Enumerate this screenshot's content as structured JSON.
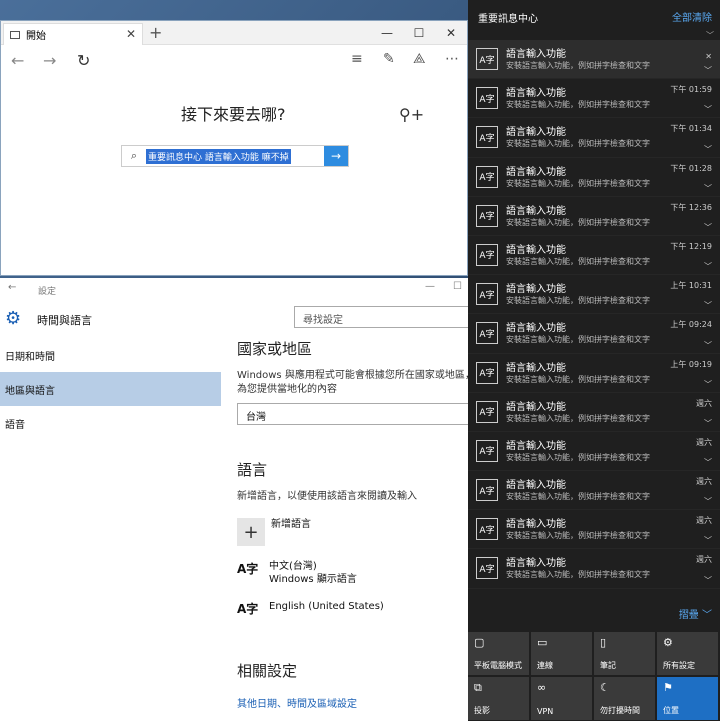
{
  "edge": {
    "tab_title": "開始",
    "heading": "接下來要去哪?",
    "search_value": "重要訊息中心 語言輸入功能 嘛不掉"
  },
  "settings": {
    "window_title": "設定",
    "section_title": "時間與語言",
    "search_placeholder": "尋找設定",
    "menu": [
      "日期和時間",
      "地區與語言",
      "語音"
    ],
    "country_heading": "國家或地區",
    "country_desc": "Windows 與應用程式可能會根據您所在國家或地區，為您提供當地化的內容",
    "country_value": "台灣",
    "lang_heading": "語言",
    "lang_desc": "新增語言，以便使用該語言來閱讀及輸入",
    "add_lang_label": "新增語言",
    "lang1_name": "中文(台灣)",
    "lang1_sub": "Windows 顯示語言",
    "lang2_name": "English (United States)",
    "related_heading": "相關設定",
    "related_link": "其他日期、時間及區域設定"
  },
  "action_center": {
    "title": "重要訊息中心",
    "clear_all": "全部清除",
    "collapse": "摺疊",
    "notifications": [
      {
        "title": "語言輸入功能",
        "body": "安裝語言輸入功能，例如拼字檢查和文字",
        "time": ""
      },
      {
        "title": "語言輸入功能",
        "body": "安裝語言輸入功能，例如拼字檢查和文字",
        "time": "下午 01:59"
      },
      {
        "title": "語言輸入功能",
        "body": "安裝語言輸入功能，例如拼字檢查和文字",
        "time": "下午 01:34"
      },
      {
        "title": "語言輸入功能",
        "body": "安裝語言輸入功能，例如拼字檢查和文字",
        "time": "下午 01:28"
      },
      {
        "title": "語言輸入功能",
        "body": "安裝語言輸入功能，例如拼字檢查和文字",
        "time": "下午 12:36"
      },
      {
        "title": "語言輸入功能",
        "body": "安裝語言輸入功能，例如拼字檢查和文字",
        "time": "下午 12:19"
      },
      {
        "title": "語言輸入功能",
        "body": "安裝語言輸入功能，例如拼字檢查和文字",
        "time": "上午 10:31"
      },
      {
        "title": "語言輸入功能",
        "body": "安裝語言輸入功能，例如拼字檢查和文字",
        "time": "上午 09:24"
      },
      {
        "title": "語言輸入功能",
        "body": "安裝語言輸入功能，例如拼字檢查和文字",
        "time": "上午 09:19"
      },
      {
        "title": "語言輸入功能",
        "body": "安裝語言輸入功能，例如拼字檢查和文字",
        "time": "週六"
      },
      {
        "title": "語言輸入功能",
        "body": "安裝語言輸入功能，例如拼字檢查和文字",
        "time": "週六"
      },
      {
        "title": "語言輸入功能",
        "body": "安裝語言輸入功能，例如拼字檢查和文字",
        "time": "週六"
      },
      {
        "title": "語言輸入功能",
        "body": "安裝語言輸入功能，例如拼字檢查和文字",
        "time": "週六"
      },
      {
        "title": "語言輸入功能",
        "body": "安裝語言輸入功能，例如拼字檢查和文字",
        "time": "週六"
      }
    ],
    "tiles": [
      {
        "label": "平板電腦模式",
        "icon": "tablet-icon",
        "on": false
      },
      {
        "label": "連線",
        "icon": "connect-icon",
        "on": false
      },
      {
        "label": "筆記",
        "icon": "note-icon",
        "on": false
      },
      {
        "label": "所有設定",
        "icon": "settings-icon",
        "on": false
      },
      {
        "label": "投影",
        "icon": "project-icon",
        "on": false
      },
      {
        "label": "VPN",
        "icon": "vpn-icon",
        "on": false
      },
      {
        "label": "勿打擾時間",
        "icon": "moon-icon",
        "on": false
      },
      {
        "label": "位置",
        "icon": "location-icon",
        "on": true
      }
    ]
  },
  "colors": {
    "accent": "#1e6fc4",
    "selection": "#b7cde6",
    "action_center_bg": "#1f1f1f"
  }
}
